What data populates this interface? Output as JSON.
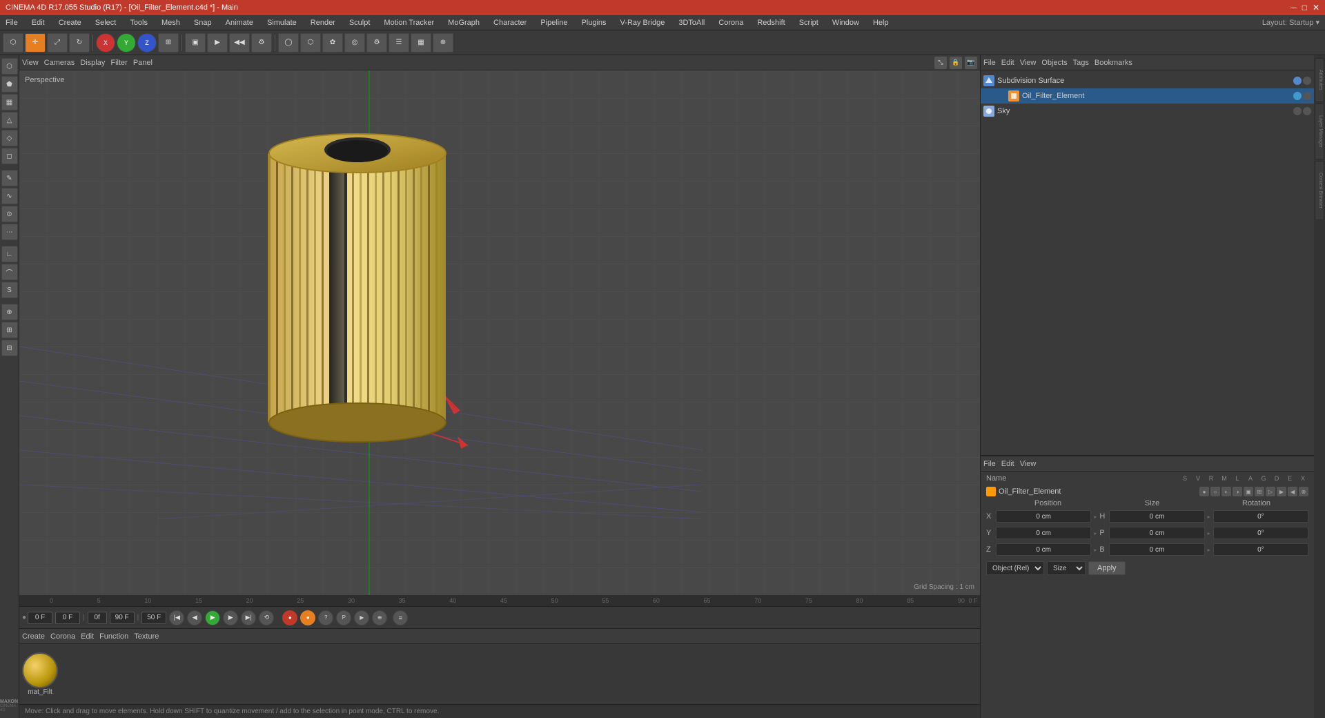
{
  "titlebar": {
    "title": "CINEMA 4D R17.055 Studio (R17) - [Oil_Filter_Element.c4d *] - Main",
    "controls": [
      "─",
      "□",
      "✕"
    ]
  },
  "menubar": {
    "items": [
      "File",
      "Edit",
      "Create",
      "Select",
      "Tools",
      "Mesh",
      "Snap",
      "Animate",
      "Simulate",
      "Render",
      "Sculpt",
      "Motion Tracker",
      "MoGraph",
      "Character",
      "Pipeline",
      "Plugins",
      "V-Ray Bridge",
      "3DToAll",
      "Corona",
      "Redshift",
      "Script",
      "Window",
      "Help"
    ]
  },
  "layout": {
    "label": "Layout:",
    "value": "Startup"
  },
  "viewport": {
    "perspective_label": "Perspective",
    "grid_spacing": "Grid Spacing : 1 cm",
    "toolbar_items": [
      "View",
      "Cameras",
      "Display",
      "Filter",
      "Panel"
    ]
  },
  "timeline": {
    "start_frame": "0 F",
    "end_frame": "90 F",
    "current_frame": "0 F",
    "fps": "0f",
    "ticks": [
      "0",
      "5",
      "10",
      "15",
      "20",
      "25",
      "30",
      "35",
      "40",
      "45",
      "50",
      "55",
      "60",
      "65",
      "70",
      "75",
      "80",
      "85",
      "90"
    ]
  },
  "right_panel": {
    "top_toolbar": [
      "File",
      "Edit",
      "View",
      "Objects",
      "Tags",
      "Bookmarks"
    ],
    "objects": [
      {
        "name": "Subdivision Surface",
        "icon_color": "#5588cc",
        "indent": 0
      },
      {
        "name": "Oil_Filter_Element",
        "icon_color": "#f09030",
        "indent": 1
      },
      {
        "name": "Sky",
        "icon_color": "#88aadd",
        "indent": 0
      }
    ],
    "bottom_toolbar": [
      "File",
      "Edit",
      "View"
    ],
    "name_label": "Name",
    "col_headers": [
      "S",
      "V",
      "R",
      "M",
      "L",
      "A",
      "G",
      "D",
      "E",
      "X"
    ],
    "object_name": "Oil_Filter_Element",
    "coord_section": {
      "headers": [
        "Position",
        "Size",
        "Rotation"
      ],
      "rows": [
        {
          "label": "X",
          "pos": "0 cm",
          "size": "0 cm",
          "rot": "0°"
        },
        {
          "label": "Y",
          "pos": "0 cm",
          "size": "0 cm",
          "rot": "0°"
        },
        {
          "label": "Z",
          "pos": "0 cm",
          "size": "0 cm",
          "rot": "0°"
        }
      ]
    },
    "object_select": "Object (Rel)",
    "size_select": "Size",
    "apply_label": "Apply"
  },
  "bottom_material": {
    "toolbar_items": [
      "Create",
      "Corona",
      "Edit",
      "Function",
      "Texture"
    ],
    "material_name": "mat_Filt"
  },
  "statusbar": {
    "text": "Move: Click and drag to move elements. Hold down SHIFT to quantize movement / add to the selection in point mode, CTRL to remove."
  },
  "side_tabs": [
    "Attributes",
    "Layer Manager",
    "Content Browser"
  ]
}
